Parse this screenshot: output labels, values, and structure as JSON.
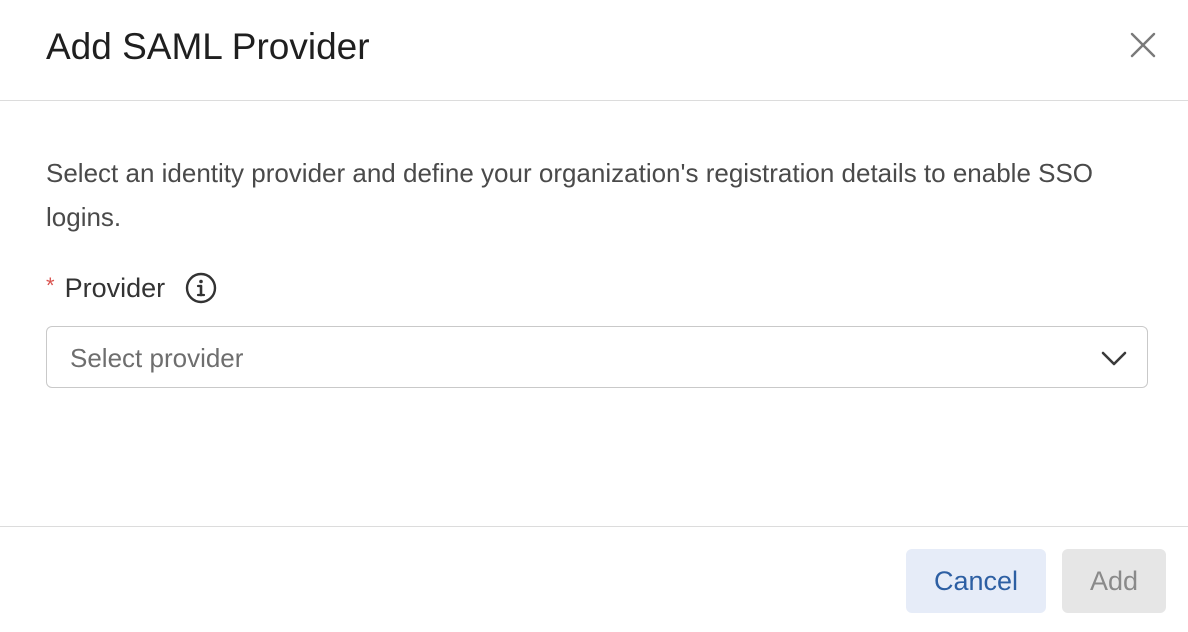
{
  "dialog": {
    "title": "Add SAML Provider",
    "close_icon": "close-icon",
    "description": "Select an identity provider and define your organization's registration details to enable SSO logins."
  },
  "provider_field": {
    "required_marker": "*",
    "label": "Provider",
    "info_icon": "info-icon",
    "placeholder": "Select provider",
    "selected_value": "",
    "chevron_icon": "chevron-down-icon"
  },
  "footer": {
    "cancel_label": "Cancel",
    "add_label": "Add",
    "add_disabled": true
  },
  "colors": {
    "required": "#d9534f",
    "cancel_bg": "#e6ecf8",
    "cancel_text": "#2d5fa3",
    "add_bg_disabled": "#e6e6e6",
    "add_text_disabled": "#8a8a8a"
  }
}
